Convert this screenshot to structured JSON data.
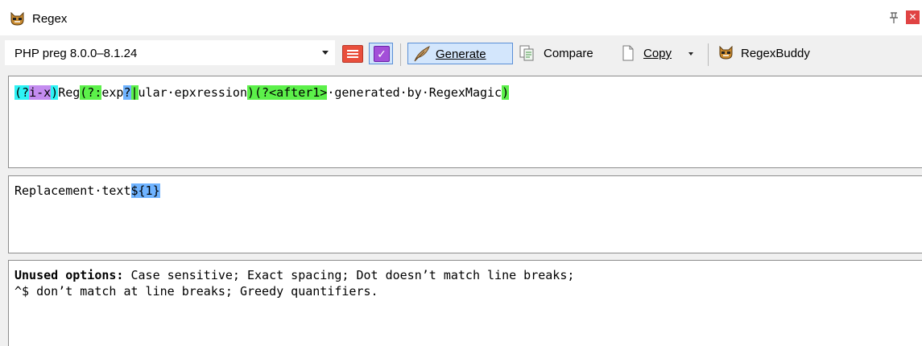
{
  "window": {
    "title": "Regex"
  },
  "toolbar": {
    "flavor": "PHP preg 8.0.0–8.1.24",
    "generate_label": "Generate",
    "compare_label": "Compare",
    "copy_label": "Copy",
    "regexbuddy_label": "RegexBuddy"
  },
  "regex": {
    "tokens": [
      {
        "text": "(?",
        "color": "cyan"
      },
      {
        "text": "i-x",
        "color": "purple"
      },
      {
        "text": ")",
        "color": "cyan"
      },
      {
        "text": "Reg",
        "color": ""
      },
      {
        "text": "(?:",
        "color": "green"
      },
      {
        "text": "exp",
        "color": ""
      },
      {
        "text": "?",
        "color": "blue"
      },
      {
        "text": "|",
        "color": "green"
      },
      {
        "text": "ular·epxression",
        "color": ""
      },
      {
        "text": ")",
        "color": "green"
      },
      {
        "text": "(?<after1>",
        "color": "green"
      },
      {
        "text": "·generated·by·RegexMagic",
        "color": ""
      },
      {
        "text": ")",
        "color": "green"
      }
    ]
  },
  "replacement": {
    "text": "Replacement·text",
    "backref": "${1}"
  },
  "info": {
    "label": "Unused options:",
    "line1": " Case sensitive; Exact spacing; Dot doesn’t match line breaks;",
    "line2": "^$ don’t match at line breaks; Greedy quantifiers."
  },
  "colors": {
    "cyan": "#2ef3f5",
    "purple": "#c48cf0",
    "green": "#5cf04a",
    "blue": "#6fb3ff"
  },
  "icons": [
    "regexbuddy-logo-icon",
    "pin-icon",
    "close-icon",
    "dropdown-arrow-icon",
    "comment-icon",
    "checkbox-icon",
    "feather-icon",
    "compare-icon",
    "copy-icon"
  ]
}
